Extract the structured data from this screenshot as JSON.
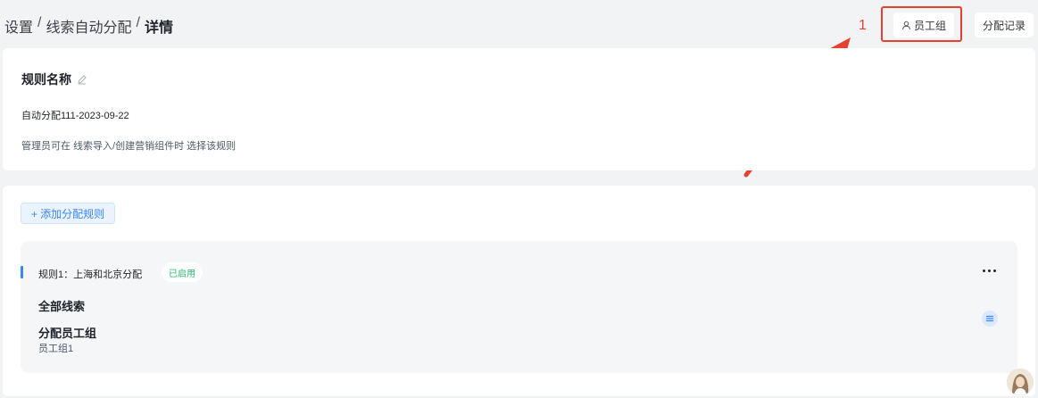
{
  "breadcrumb": {
    "items": [
      "设置",
      "线索自动分配"
    ],
    "separator": "/",
    "current": "详情"
  },
  "header": {
    "annotation_number": "1",
    "group_button": "员工组",
    "records_button": "分配记录"
  },
  "rule_info": {
    "title": "规则名称",
    "name_value": "自动分配111-2023-09-22",
    "description": "管理员可在 线索导入/创建营销组件时 选择该规则"
  },
  "rules_section": {
    "add_button": "+ 添加分配规则",
    "rule": {
      "title": "规则1：上海和北京分配",
      "status": "已启用",
      "scope": "全部线索",
      "assign_title": "分配员工组",
      "assign_value": "员工组1"
    }
  },
  "colors": {
    "accent": "#3a86ff",
    "annotation": "#e8402f",
    "enabled": "#2fb96c"
  }
}
